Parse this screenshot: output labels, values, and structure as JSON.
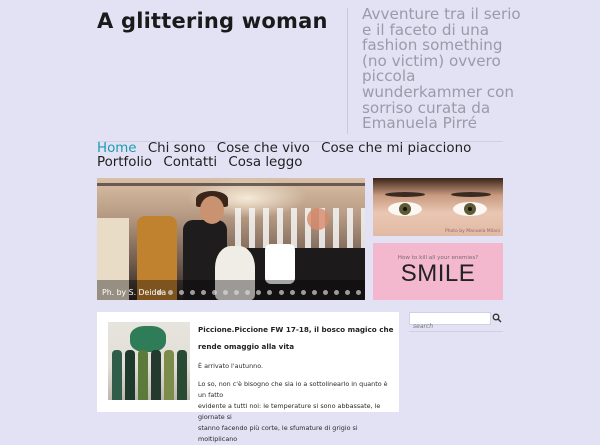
{
  "header": {
    "title": "A glittering woman",
    "tagline": "Avventure tra il serio e il faceto di una fashion something (no victim) ovvero piccola wunderkammer con sorriso curata da Emanuela Pirré"
  },
  "nav": {
    "items": [
      {
        "label": "Home",
        "active": true
      },
      {
        "label": "Chi sono",
        "active": false
      },
      {
        "label": "Cose che vivo",
        "active": false
      },
      {
        "label": "Cose che mi piacciono",
        "active": false
      },
      {
        "label": "Portfolio",
        "active": false
      },
      {
        "label": "Contatti",
        "active": false
      },
      {
        "label": "Cosa leggo",
        "active": false
      }
    ]
  },
  "slider": {
    "caption": "Ph. by S. Deidda",
    "slide_count": 19
  },
  "sidebar": {
    "eyes_credit": "Photo by Manuela Milani",
    "smile_small": "How to kill all your enemies?",
    "smile_big": "SMILE",
    "search_placeholder": "search"
  },
  "post": {
    "title": "Piccione.Piccione FW 17-18, il bosco magico che rende omaggio alla vita",
    "intro": "È arrivato l'autunno.",
    "body_lines": [
      "Lo so, non c'è bisogno che sia io a sottolinearlo in quanto è un fatto",
      "evidente a tutti noi: le temperature si sono abbassate, le giornate si",
      "stanno facendo più corte, le sfumature di grigio si moltiplicano"
    ]
  },
  "colors": {
    "background": "#e3e2f5",
    "nav_active": "#1b9bb0",
    "tagline": "#9a9aa8"
  }
}
